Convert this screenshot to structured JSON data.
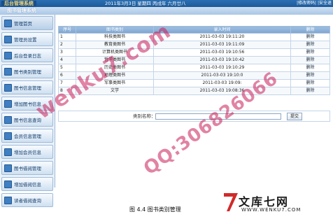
{
  "header": {
    "logo_text": "后台管理系统",
    "datetime": "2011年3月3日 星期四 丙戌年 六月廿八",
    "links": [
      "|修改密码|",
      "|安全退"
    ],
    "system_title": "图书管理系统"
  },
  "sidebar": {
    "items": [
      {
        "label": "管理首页"
      },
      {
        "label": "管理员设置"
      },
      {
        "label": "后台登录日志"
      },
      {
        "label": "图书类别管理"
      },
      {
        "label": "图书信息管理"
      },
      {
        "label": "增加图书信息"
      },
      {
        "label": "图书信息查询"
      },
      {
        "label": "会员信息管理"
      },
      {
        "label": "增加会员信息"
      },
      {
        "label": "图书借阅管理"
      },
      {
        "label": "增加借阅信息"
      },
      {
        "label": "读者借阅查询"
      }
    ]
  },
  "table": {
    "headers": [
      "序号",
      "图书类别",
      "录入时间",
      "删除"
    ],
    "rows": [
      [
        "1",
        "科技类图书",
        "2011-03-03 19:11:20",
        "删除"
      ],
      [
        "2",
        "教育类图书",
        "2011-03-03 19:11:09",
        "删除"
      ],
      [
        "3",
        "计算机类图书",
        "2011-03-03 19:10:56",
        "删除"
      ],
      [
        "4",
        "哲学类图书",
        "2011-03-03 19:10:42",
        "删除"
      ],
      [
        "5",
        "历史类图书",
        "2011-03-03 19:10:29",
        "删除"
      ],
      [
        "6",
        "地理类图书",
        "2011-03-03 19:10:0",
        "删除"
      ],
      [
        "7",
        "军事类图书",
        "2011-03-03 19:09:",
        "删除"
      ],
      [
        "8",
        "文学",
        "2011-03-03 19:08:36",
        "删除"
      ]
    ]
  },
  "search": {
    "label": "类别名称：",
    "value": "",
    "button_label": "提交"
  },
  "caption": "图 4.4 图书类别管理",
  "watermarks": {
    "wenku": "wenku7.com",
    "qq": "QQ:306826066",
    "logo_text": "文库七网",
    "logo_url": "WWW.WENKU7.COM"
  },
  "colors": {
    "header_bg": "#1d5a99",
    "table_header": "#7ea6d1",
    "watermark": "#c81e5a"
  }
}
